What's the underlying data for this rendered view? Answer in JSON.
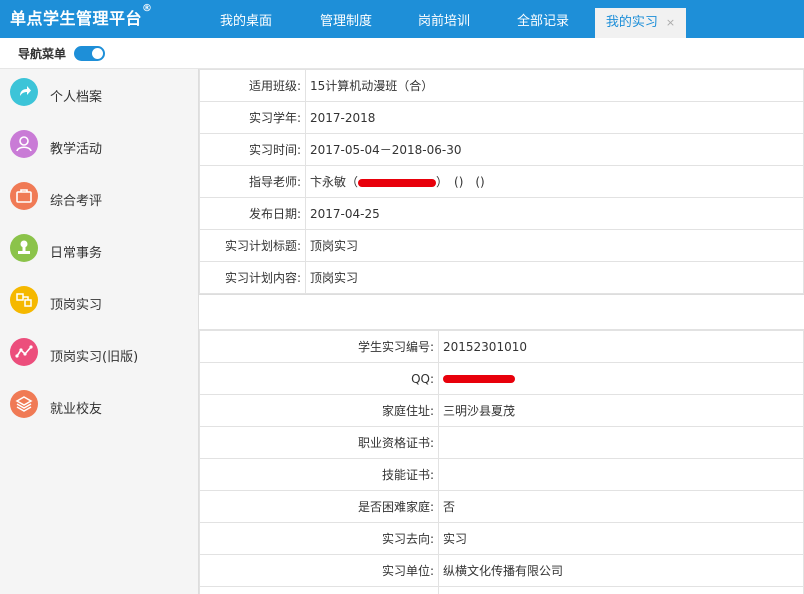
{
  "header": {
    "brand": "单点学生管理平台",
    "brand_mark": "®",
    "tabs": [
      {
        "label": "我的桌面"
      },
      {
        "label": "管理制度"
      },
      {
        "label": "岗前培训"
      },
      {
        "label": "全部记录"
      },
      {
        "label": "我的实习",
        "active": true,
        "close": "×"
      }
    ]
  },
  "subbar": {
    "nav_label": "导航菜单",
    "toggle_on": true
  },
  "sidebar": {
    "items": [
      {
        "label": "个人档案",
        "icon": "share-arrow-icon",
        "color": "#3cc4d8"
      },
      {
        "label": "教学活动",
        "icon": "user-icon",
        "color": "#c97bd6"
      },
      {
        "label": "综合考评",
        "icon": "briefcase-icon",
        "color": "#f07a55"
      },
      {
        "label": "日常事务",
        "icon": "stamp-icon",
        "color": "#8bc34a"
      },
      {
        "label": "顶岗实习",
        "icon": "network-icon",
        "color": "#f5b800"
      },
      {
        "label": "顶岗实习(旧版)",
        "icon": "trend-icon",
        "color": "#ec4e7c"
      },
      {
        "label": "就业校友",
        "icon": "layers-icon",
        "color": "#f07a55"
      }
    ]
  },
  "plan": {
    "rows": [
      {
        "label": "适用班级:",
        "value": "15计算机动漫班（合）"
      },
      {
        "label": "实习学年:",
        "value": "2017-2018"
      },
      {
        "label": "实习时间:",
        "value": "2017-05-04－2018-06-30"
      },
      {
        "label": "指导老师:",
        "value_prefix": "卞永敏（",
        "value_suffix": "）　()　()"
      },
      {
        "label": "发布日期:",
        "value": "2017-04-25"
      },
      {
        "label": "实习计划标题:",
        "value": "顶岗实习"
      },
      {
        "label": "实习计划内容:",
        "value": "顶岗实习"
      }
    ]
  },
  "student": {
    "rows": [
      {
        "label": "学生实习编号:",
        "value": "20152301010"
      },
      {
        "label": "QQ:",
        "value": ""
      },
      {
        "label": "家庭住址:",
        "value": "三明沙县夏茂"
      },
      {
        "label": "职业资格证书:",
        "value": ""
      },
      {
        "label": "技能证书:",
        "value": ""
      },
      {
        "label": "是否困难家庭:",
        "value": "否"
      },
      {
        "label": "实习去向:",
        "value": "实习"
      },
      {
        "label": "实习单位:",
        "value": "纵横文化传播有限公司"
      },
      {
        "label": "",
        "value": ""
      }
    ]
  },
  "colors": {
    "accent": "#1e8fd8",
    "redaction": "#e8000b"
  }
}
